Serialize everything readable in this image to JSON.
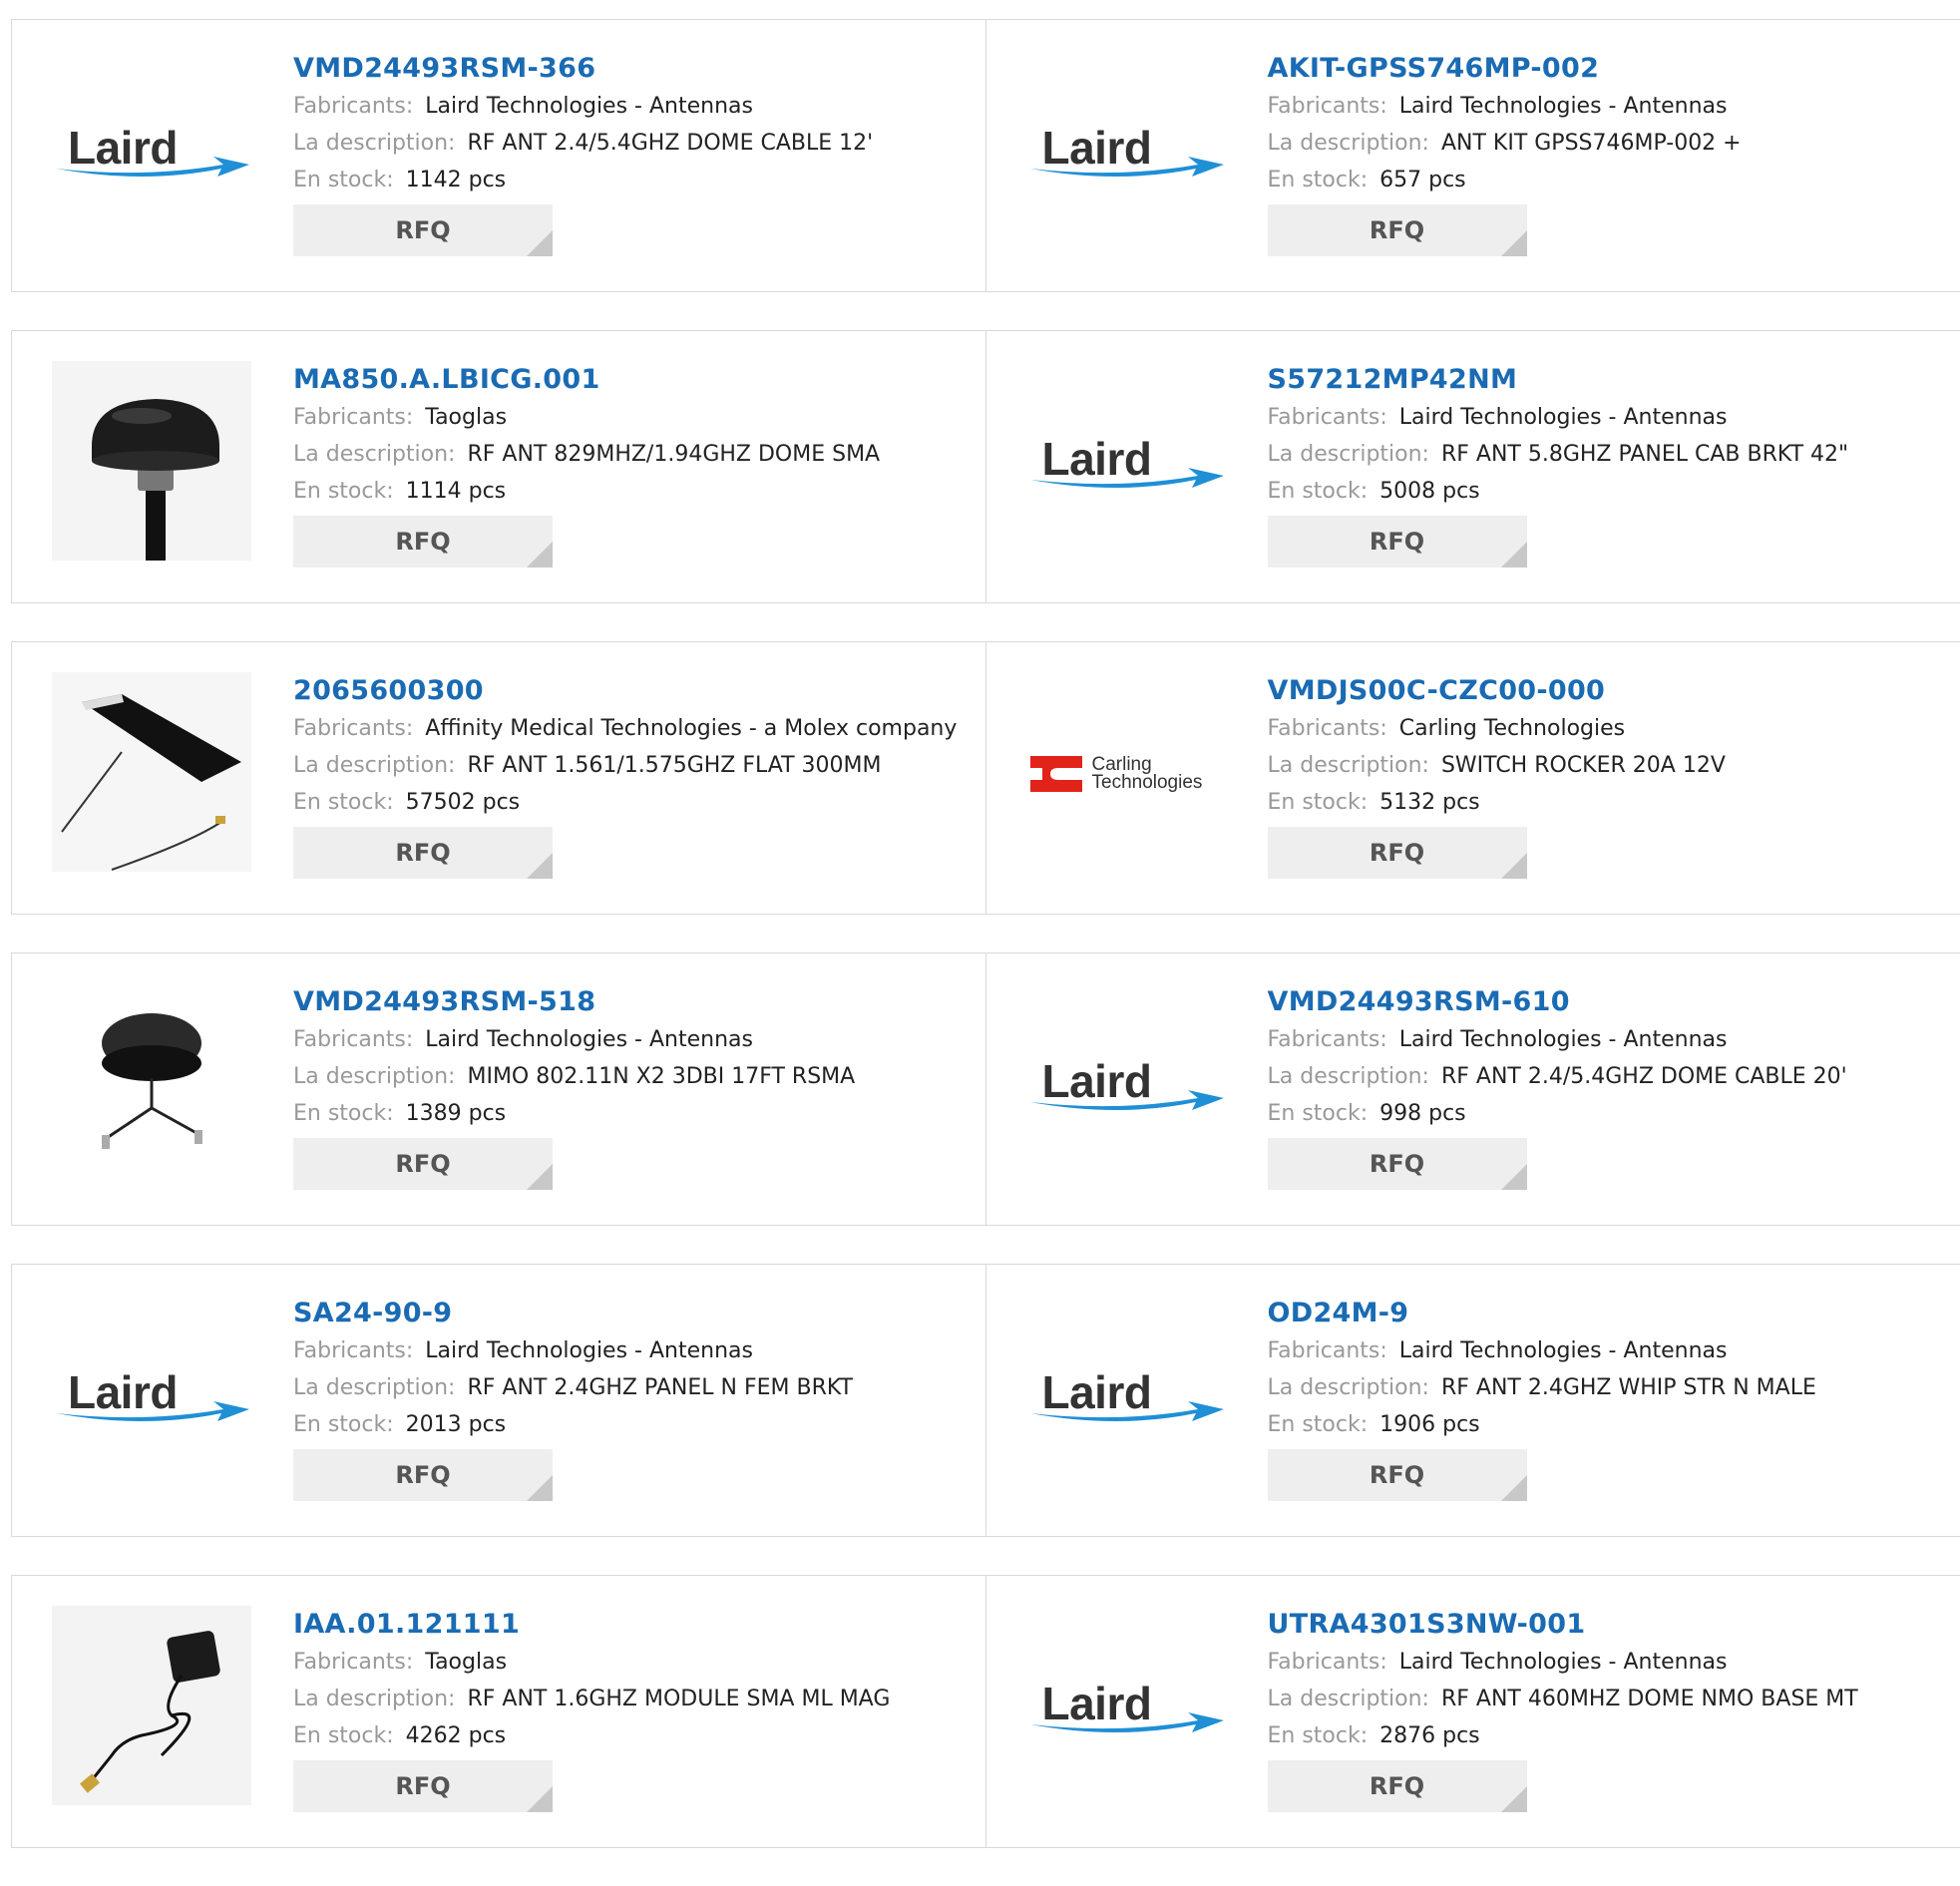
{
  "labels": {
    "manufacturer": "Fabricants:",
    "description": "La description:",
    "stock": "En stock:",
    "rfq": "RFQ"
  },
  "colors": {
    "accent": "#1a6bb3",
    "laird_swoosh": "#1f8fd6",
    "carling_red": "#e2231a"
  },
  "products": [
    {
      "pn": "VMD24493RSM-366",
      "manufacturer": "Laird Technologies - Antennas",
      "description": "RF ANT 2.4/5.4GHZ DOME CABLE 12'",
      "stock": "1142 pcs",
      "image": "laird-logo",
      "logo_text": "Laird"
    },
    {
      "pn": "AKIT-GPSS746MP-002",
      "manufacturer": "Laird Technologies - Antennas",
      "description": "ANT KIT GPSS746MP-002 +",
      "stock": "657 pcs",
      "image": "laird-logo",
      "logo_text": "Laird"
    },
    {
      "pn": "MA850.A.LBICG.001",
      "manufacturer": "Taoglas",
      "description": "RF ANT 829MHZ/1.94GHZ DOME SMA",
      "stock": "1114 pcs",
      "image": "dome-antenna-photo"
    },
    {
      "pn": "S57212MP42NM",
      "manufacturer": "Laird Technologies - Antennas",
      "description": "RF ANT 5.8GHZ PANEL CAB BRKT 42\"",
      "stock": "5008 pcs",
      "image": "laird-logo",
      "logo_text": "Laird"
    },
    {
      "pn": "2065600300",
      "manufacturer": "Affinity Medical Technologies - a Molex company",
      "description": "RF ANT 1.561/1.575GHZ FLAT 300MM",
      "stock": "57502 pcs",
      "image": "flat-antenna-photo"
    },
    {
      "pn": "VMDJS00C-CZC00-000",
      "manufacturer": "Carling Technologies",
      "description": "SWITCH ROCKER 20A 12V",
      "stock": "5132 pcs",
      "image": "carling-logo",
      "logo_line1": "Carling",
      "logo_line2": "Technologies"
    },
    {
      "pn": "VMD24493RSM-518",
      "manufacturer": "Laird Technologies - Antennas",
      "description": "MIMO 802.11N X2 3DBI 17FT RSMA",
      "stock": "1389 pcs",
      "image": "puck-antenna-photo"
    },
    {
      "pn": "VMD24493RSM-610",
      "manufacturer": "Laird Technologies - Antennas",
      "description": "RF ANT 2.4/5.4GHZ DOME CABLE 20'",
      "stock": "998 pcs",
      "image": "laird-logo",
      "logo_text": "Laird"
    },
    {
      "pn": "SA24-90-9",
      "manufacturer": "Laird Technologies - Antennas",
      "description": "RF ANT 2.4GHZ PANEL N FEM BRKT",
      "stock": "2013 pcs",
      "image": "laird-logo",
      "logo_text": "Laird"
    },
    {
      "pn": "OD24M-9",
      "manufacturer": "Laird Technologies - Antennas",
      "description": "RF ANT 2.4GHZ WHIP STR N MALE",
      "stock": "1906 pcs",
      "image": "laird-logo",
      "logo_text": "Laird"
    },
    {
      "pn": "IAA.01.121111",
      "manufacturer": "Taoglas",
      "description": "RF ANT 1.6GHZ MODULE SMA ML MAG",
      "stock": "4262 pcs",
      "image": "patch-antenna-photo"
    },
    {
      "pn": "UTRA4301S3NW-001",
      "manufacturer": "Laird Technologies - Antennas",
      "description": "RF ANT 460MHZ DOME NMO BASE MT",
      "stock": "2876 pcs",
      "image": "laird-logo",
      "logo_text": "Laird"
    }
  ]
}
